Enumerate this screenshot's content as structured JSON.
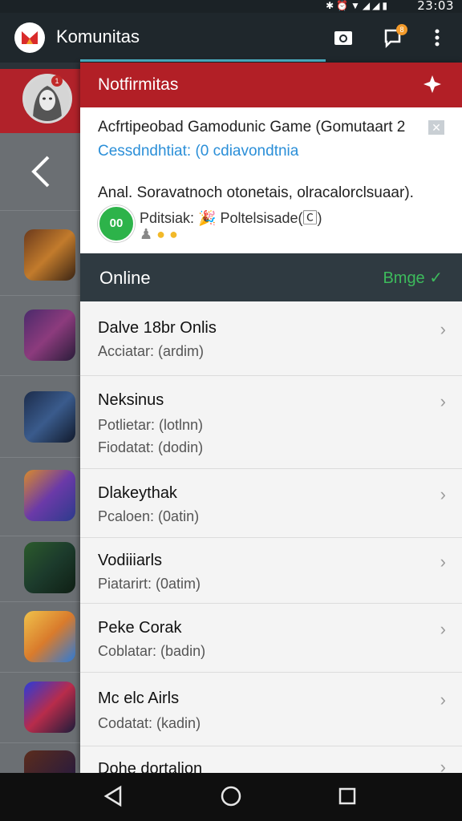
{
  "status": {
    "time": "23:03",
    "icons": [
      "bluetooth-icon",
      "alarm-icon",
      "wifi-icon",
      "signal-icon",
      "signal-icon",
      "battery-icon"
    ]
  },
  "appbar": {
    "title": "Komunitas",
    "badge_count": "8"
  },
  "notifications": {
    "title": "Notfirmitas",
    "line1": "Acfrtipeobad Gamodunic Game (Gomutaart 2",
    "line1b": "Cessdndhtiat: (0 cdiavondtnia",
    "line2": "Anal. Soravatnoch otonetais, olracalorclsuaar).",
    "line3": "Pditsiak: 🎉 Poltelsisade(🄲)",
    "avatar_text": "00"
  },
  "online": {
    "label": "Online",
    "action": "Bmge ✓"
  },
  "list": [
    {
      "name": "Dalve 18br Onlis",
      "sub1": "Acciatar: (ardim)",
      "sub2": ""
    },
    {
      "name": "Neksinus",
      "sub1": "Potlietar: (lotlnn)",
      "sub2": "Fiodatat: (dodin)"
    },
    {
      "name": "Dlakeythak",
      "sub1": "Pcaloen: (0atin)",
      "sub2": ""
    },
    {
      "name": "Vodiiiarls",
      "sub1": "Piatarirt: (0atim)",
      "sub2": ""
    },
    {
      "name": "Peke Corak",
      "sub1": "Coblatar: (badin)",
      "sub2": ""
    },
    {
      "name": "Mc elc Airls",
      "sub1": "Codatat: (kadin)",
      "sub2": ""
    },
    {
      "name": "Dohe dortalion",
      "sub1": "",
      "sub2": ""
    }
  ],
  "colors": {
    "accent_red": "#b21f26",
    "online_green": "#3dbb5c",
    "link_blue": "#2b8fd8"
  }
}
